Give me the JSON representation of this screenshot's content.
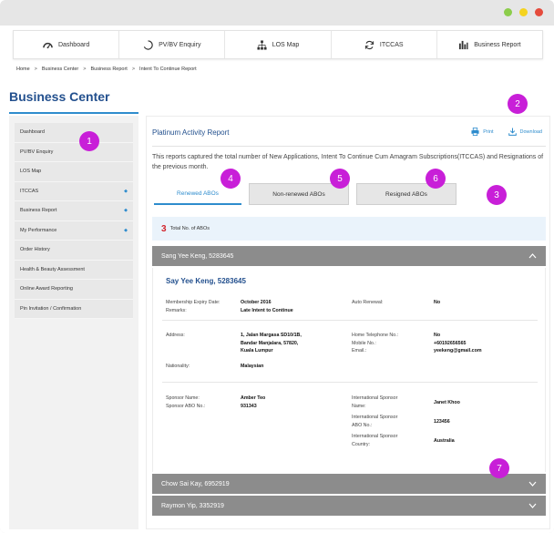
{
  "window": {
    "dots": [
      "#8ccd4b",
      "#f5d31f",
      "#e54b3c"
    ]
  },
  "topnav": [
    {
      "label": "Dashboard",
      "icon": "dashboard-icon"
    },
    {
      "label": "PV/BV Enquiry",
      "icon": "circle-progress-icon"
    },
    {
      "label": "LOS Map",
      "icon": "sitemap-icon"
    },
    {
      "label": "ITCCAS",
      "icon": "refresh-icon"
    },
    {
      "label": "Business Report",
      "icon": "bar-chart-icon"
    }
  ],
  "breadcrumb": [
    "Home",
    "Business Center",
    "Business Report",
    "Intent To Continue Report"
  ],
  "breadcrumb_sep": ">",
  "page_title": "Business Center",
  "sidebar": [
    {
      "label": "Dashboard",
      "arrow": ""
    },
    {
      "label": "PV/BV Enquiry",
      "arrow": ""
    },
    {
      "label": "LOS Map",
      "arrow": ""
    },
    {
      "label": "ITCCAS",
      "arrow": "◆"
    },
    {
      "label": "Business Report",
      "arrow": "◆"
    },
    {
      "label": "My Performance",
      "arrow": "◆"
    },
    {
      "label": "Order History",
      "arrow": ""
    },
    {
      "label": "Health & Beauty Assessment",
      "arrow": ""
    },
    {
      "label": "Online Award Reporting",
      "arrow": ""
    },
    {
      "label": "Pin Invitation / Confirmation",
      "arrow": ""
    }
  ],
  "report": {
    "title": "Platinum Activity Report",
    "print": "Print",
    "download": "Download",
    "description": "This reports captured the total number of New Applications, Intent To Continue Cum Amagram Subscriptions(ITCCAS) and Resignations of the previous month."
  },
  "tabs": [
    "Renewed ABOs",
    "Non-renewed ABOs",
    "Resigned ABOs"
  ],
  "total": {
    "count": "3",
    "label": "Total No. of ABOs"
  },
  "accordions": [
    {
      "header": "Sang Yee Keng, 5283645",
      "expanded": true
    },
    {
      "header": "Chow Sai Kay, 6952919",
      "expanded": false
    },
    {
      "header": "Raymon Yip, 3352919",
      "expanded": false
    }
  ],
  "member": {
    "name": "Say Yee Keng, 5283645",
    "expiry_label": "Membership Expiry Date:",
    "expiry_value": "October 2016",
    "remarks_label": "Remarks:",
    "remarks_value": "Late Intent to Continue",
    "auto_renewal_label": "Auto Renewal:",
    "auto_renewal_value": "No",
    "address_label": "Address:",
    "address_lines": [
      "1, Jalan Margasa SD10/1B,",
      "Bandar Manjalara, 57820,",
      "Kuala Lumpur"
    ],
    "nationality_label": "Nationality:",
    "nationality_value": "Malaysian",
    "home_tel_label": "Home Telephone No.:",
    "home_tel_value": "No",
    "mobile_label": "Mobile No.:",
    "mobile_value": "+60192656565",
    "email_label": "Email.:",
    "email_value": "yeekeng@gmail.com",
    "sponsor_name_label": "Sponsor Name:",
    "sponsor_name_value": "Amber Teo",
    "sponsor_abo_label": "Sponsor ABO No.:",
    "sponsor_abo_value": "931343",
    "intl_name_label": [
      "International Sponsor",
      "Name:"
    ],
    "intl_name_value": "Janet Khoo",
    "intl_abo_label": [
      "International Sponsor",
      "ABO No.:"
    ],
    "intl_abo_value": "123456",
    "intl_country_label": [
      "International Sponsor",
      "Country:"
    ],
    "intl_country_value": "Australia"
  },
  "callouts": [
    "1",
    "2",
    "3",
    "4",
    "5",
    "6",
    "7"
  ],
  "colors": {
    "brand_blue": "#23508e",
    "accent_blue": "#2e8ccd",
    "callout_purple": "#c81fd8",
    "accordion_gray": "#8c8c8c"
  }
}
